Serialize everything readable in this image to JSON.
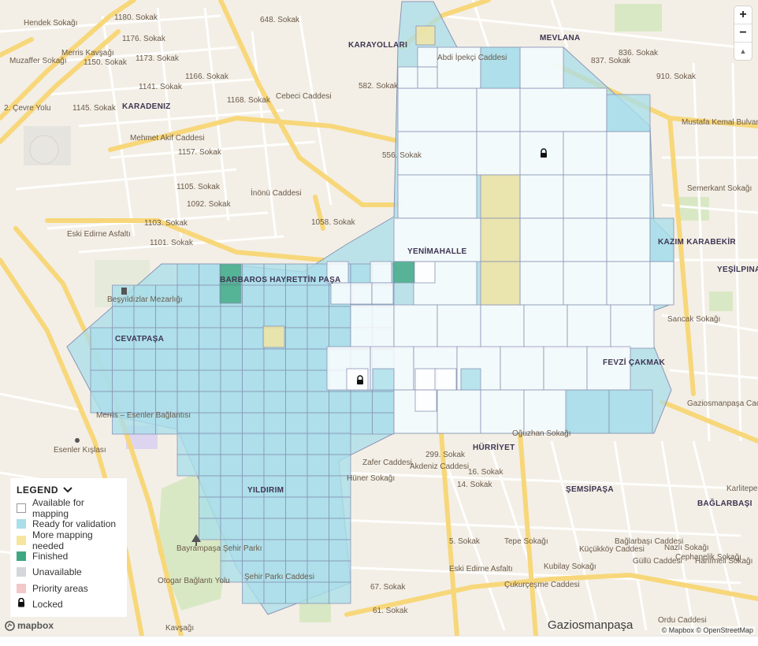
{
  "map": {
    "colors": {
      "land": "#f3efe6",
      "major_road": "#f7d77a",
      "minor_road": "#ffffff",
      "park": "#d9e8c4",
      "ready": "#aadeea",
      "available": "#ffffff",
      "more_mapping": "#f5e59f",
      "finished": "#3fa781",
      "cell_border": "#8a94b6"
    },
    "street_labels": [
      "Hendek Sokağı",
      "1180. Sokak",
      "1176. Sokak",
      "1173. Sokak",
      "1141. Sokak",
      "1145. Sokak",
      "Mehmet Akif Caddesi",
      "1157. Sokak",
      "1168. Sokak",
      "1166. Sokak",
      "1105. Sokak",
      "1092. Sokak",
      "1103. Sokak",
      "1101. Sokak",
      "Eski Edirne Asfaltı",
      "648. Sokak",
      "Cebeci Caddesi",
      "582. Sokak",
      "556. Sokak",
      "İnönü Caddesi",
      "1058. Sokak",
      "Muzaffer Sokağı",
      "Merris Kavşağı",
      "1150. Sokak",
      "2. Çevre Yolu",
      "Abdi İpekçi Caddesi",
      "836. Sokak",
      "837. Sokak",
      "910. Sokak",
      "Mustafa Kemal Bulvarı",
      "Semerkant Sokağı",
      "Sancak Sokağı",
      "Gaziosmanpaşa Caddesi",
      "299. Sokak",
      "16. Sokak",
      "14. Sokak",
      "Tepe Sokağı",
      "Kubilay Sokağı",
      "Küçükköy Caddesi",
      "Bağlarbaşı Caddesi",
      "Güllü Caddesi",
      "Nazlı Sokağı",
      "Cephanelik Sokağı",
      "Hanımeli Sokağı",
      "Ordu Caddesi",
      "Çukurçeşme Caddesi",
      "Eski Edirne Asfaltı",
      "67. Sokak",
      "61. Sokak",
      "5. Sokak",
      "Hüner Sokağı",
      "Zafer Caddesi",
      "Akdeniz Caddesi",
      "Şehir Parkı Caddesi",
      "Oğuzhan Sokağı",
      "Merris – Esenler Bağlantısı",
      "Otogar Bağlantı Yolu",
      "Kavşağı"
    ],
    "area_labels": [
      "KARAYOLLARI",
      "MEVLANA",
      "KARADENIZ",
      "YENİMAHALLE",
      "KAZIM KARABEKİR",
      "YEŞİLPINAR",
      "BARBAROS HAYRETTİN PAŞA",
      "CEVATPAŞA",
      "FEVZİ ÇAKMAK",
      "HÜRRİYET",
      "ŞEMSİPAŞA",
      "BAĞLARBAŞI",
      "YILDIRIM"
    ],
    "poi_labels": [
      "Beşyıldızlar Mezarlığı",
      "Esenler Kışlası",
      "Bayrampaşa Şehir Parkı",
      "Karlitepe"
    ],
    "city_label": "Gaziosmanpaşa",
    "locked_cells": 2
  },
  "zoom": {
    "in_label": "+",
    "out_label": "−",
    "compass_label": "▲"
  },
  "legend": {
    "title": "LEGEND",
    "toggle_icon": "chevron-down-icon",
    "items": [
      {
        "label": "Available for mapping",
        "color": "#ffffff",
        "border": "#999999"
      },
      {
        "label": "Ready for validation",
        "color": "#aadeea",
        "border": "#aadeea"
      },
      {
        "label": "More mapping needed",
        "color": "#f5e59f",
        "border": "#f5e59f"
      },
      {
        "label": "Finished",
        "color": "#3fa781",
        "border": "#3fa781"
      },
      {
        "label": "Unavailable",
        "color": "#d4d6dc",
        "border": "#d4d6dc"
      },
      {
        "label": "Priority areas",
        "color": "#f2c8c8",
        "border": "#f2c8c8"
      },
      {
        "label": "Locked",
        "icon": "lock-icon"
      }
    ]
  },
  "footer": {
    "logo": "mapbox",
    "attribution": "© Mapbox © OpenStreetMap"
  }
}
